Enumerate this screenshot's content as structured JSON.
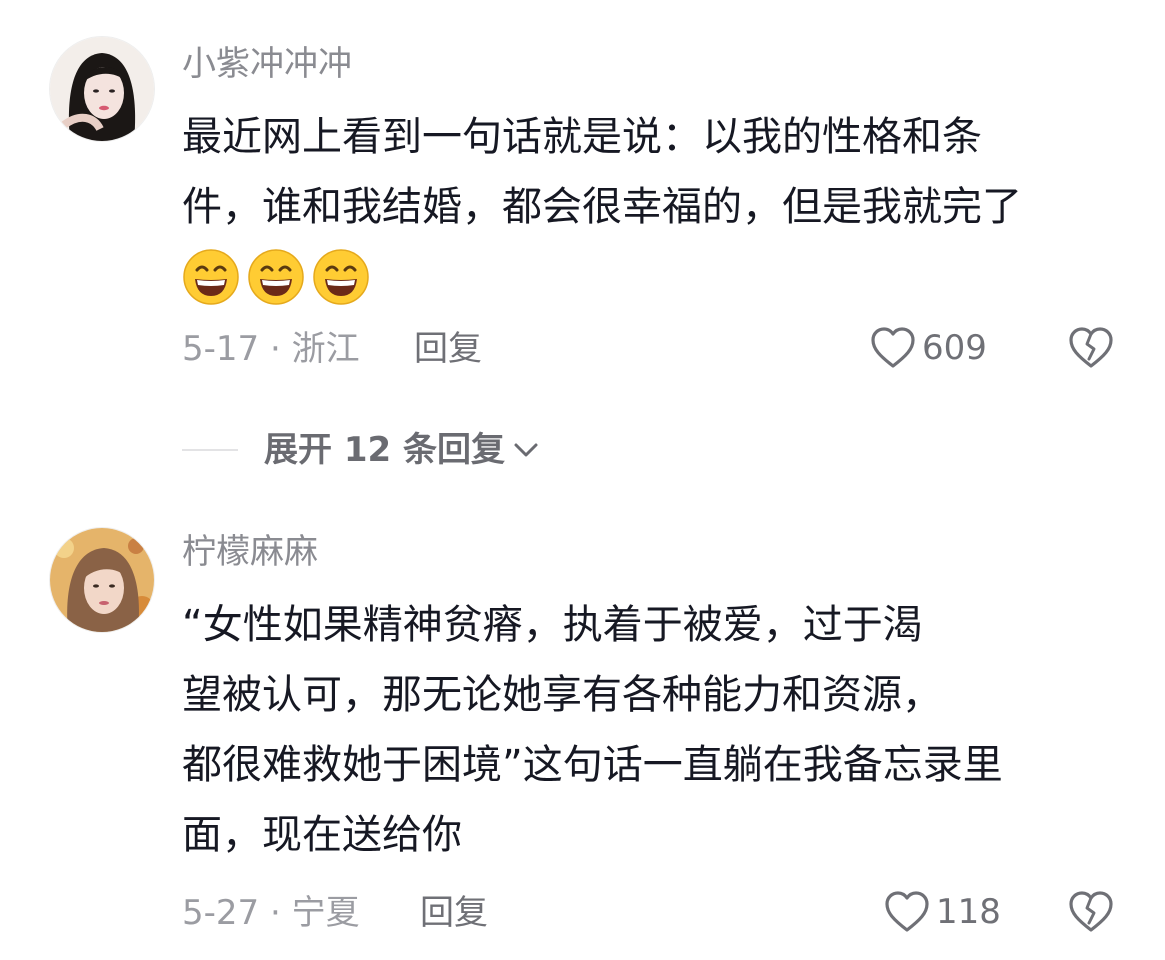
{
  "comments": [
    {
      "username": "小紫冲冲冲",
      "avatar_icon": "avatar-woman-dark-hair",
      "lines": [
        "最近网上看到一句话就是说：以我的性格和条",
        "件，谁和我结婚，都会很幸福的，但是我就完了"
      ],
      "emojis": [
        "grinning-face-icon",
        "grinning-face-icon",
        "grinning-face-icon"
      ],
      "meta": "5-17 · 浙江",
      "reply_label": "回复",
      "likes": "609",
      "expand_label": "展开 12 条回复"
    },
    {
      "username": "柠檬麻麻",
      "avatar_icon": "avatar-woman-light-hair",
      "lines": [
        "“女性如果精神贫瘠，执着于被爱，过于渴",
        "望被认可，那无论她享有各种能力和资源，",
        "都很难救她于困境”这句话一直躺在我备忘录里",
        "面，现在送给你"
      ],
      "meta": "5-27 · 宁夏",
      "reply_label": "回复",
      "likes": "118"
    }
  ],
  "colors": {
    "text": "#161823",
    "secondary": "#8a8b91",
    "emoji_face": "#ffcc33"
  }
}
